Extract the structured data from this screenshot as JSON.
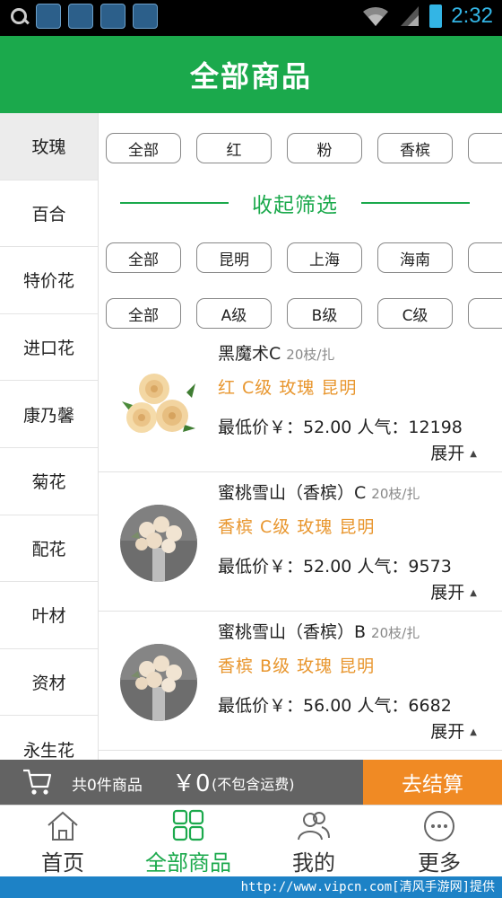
{
  "status_bar": {
    "time": "2:32"
  },
  "header": {
    "title": "全部商品"
  },
  "sidebar": {
    "items": [
      {
        "label": "玫瑰",
        "active": true
      },
      {
        "label": "百合"
      },
      {
        "label": "特价花"
      },
      {
        "label": "进口花"
      },
      {
        "label": "康乃馨"
      },
      {
        "label": "菊花"
      },
      {
        "label": "配花"
      },
      {
        "label": "叶材"
      },
      {
        "label": "资材"
      },
      {
        "label": "永生花"
      }
    ]
  },
  "filters": {
    "color": [
      "全部",
      "红",
      "粉",
      "香槟"
    ],
    "collapse_label": "收起筛选",
    "origin": [
      "全部",
      "昆明",
      "上海",
      "海南"
    ],
    "grade": [
      "全部",
      "A级",
      "B级",
      "C级"
    ]
  },
  "products": [
    {
      "name": "黑魔术C",
      "pack": "20枝/扎",
      "tags": "红 C级 玫瑰 昆明",
      "price": "最低价￥：52.00 人气：12198",
      "expand": "展开"
    },
    {
      "name": "蜜桃雪山（香槟）C",
      "pack": "20枝/扎",
      "tags": "香槟 C级 玫瑰 昆明",
      "price": "最低价￥：52.00  人气：9573",
      "expand": "展开"
    },
    {
      "name": "蜜桃雪山（香槟）B",
      "pack": "20枝/扎",
      "tags": "香槟 B级 玫瑰 昆明",
      "price": "最低价￥：56.00  人气：6682",
      "expand": "展开"
    }
  ],
  "cart": {
    "count_text": "共0件商品",
    "total": "￥0",
    "note": "(不包含运费)",
    "checkout_label": "去结算"
  },
  "bottom_nav": [
    {
      "label": "首页",
      "icon": "home-icon"
    },
    {
      "label": "全部商品",
      "icon": "grid-icon",
      "active": true
    },
    {
      "label": "我的",
      "icon": "users-icon"
    },
    {
      "label": "更多",
      "icon": "more-icon"
    }
  ],
  "watermark": "http://www.vipcn.com[清风手游网]提供",
  "colors": {
    "brand_green": "#1ba94c",
    "accent_orange": "#f08a24",
    "tag_orange": "#e8962e"
  }
}
